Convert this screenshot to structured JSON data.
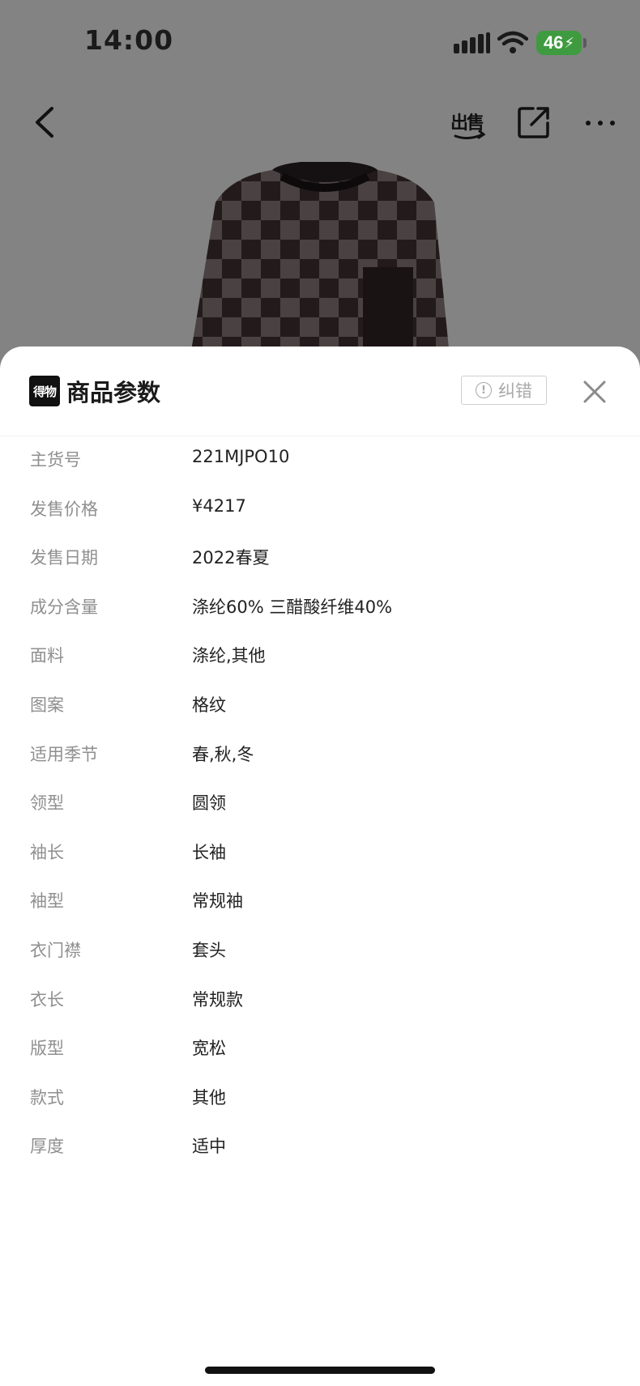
{
  "status_bar": {
    "time": "14:00",
    "battery": "46"
  },
  "nav": {
    "back_icon": "chevron-left-icon",
    "sell_label": "出售",
    "share_icon": "share-external-icon",
    "more_icon": "more-dots-icon"
  },
  "sheet": {
    "brand_logo_text": "得物",
    "title": "商品参数",
    "report_label": "纠错",
    "close_icon": "close-icon",
    "params": [
      {
        "key": "主货号",
        "value": "221MJPO10"
      },
      {
        "key": "发售价格",
        "value": "¥4217"
      },
      {
        "key": "发售日期",
        "value": "2022春夏"
      },
      {
        "key": "成分含量",
        "value": "涤纶60% 三醋酸纤维40%"
      },
      {
        "key": "面料",
        "value": "涤纶,其他"
      },
      {
        "key": "图案",
        "value": "格纹"
      },
      {
        "key": "适用季节",
        "value": "春,秋,冬"
      },
      {
        "key": "领型",
        "value": "圆领"
      },
      {
        "key": "袖长",
        "value": "长袖"
      },
      {
        "key": "袖型",
        "value": "常规袖"
      },
      {
        "key": "衣门襟",
        "value": "套头"
      },
      {
        "key": "衣长",
        "value": "常规款"
      },
      {
        "key": "版型",
        "value": "宽松"
      },
      {
        "key": "款式",
        "value": "其他"
      },
      {
        "key": "厚度",
        "value": "适中"
      }
    ]
  },
  "colors": {
    "overlay_bg": "#838383",
    "sheet_bg": "#ffffff",
    "key_text": "#8f8f8f",
    "value_text": "#222222",
    "battery_green": "#3f9b3f"
  }
}
